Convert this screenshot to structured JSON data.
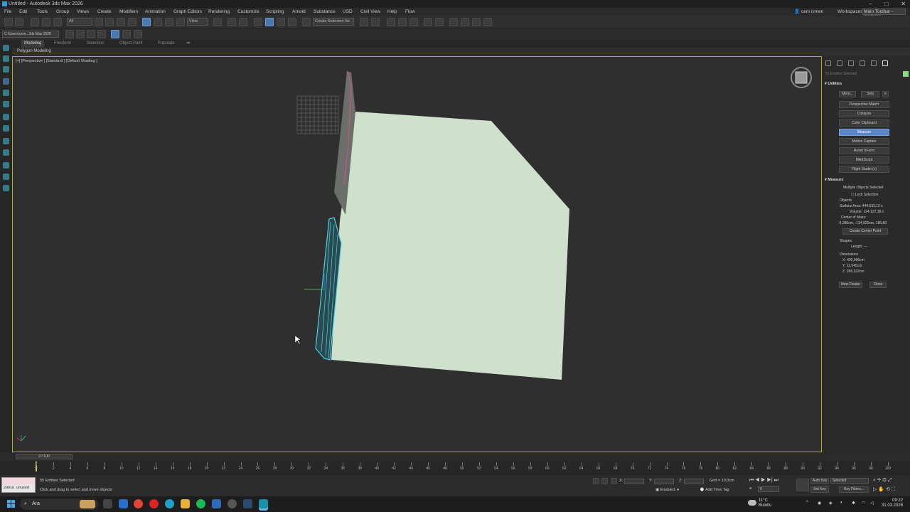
{
  "window": {
    "title": "Untitled - Autodesk 3ds Max 2026",
    "minimize": "–",
    "maximize": "□",
    "close": "✕"
  },
  "menu": {
    "items": [
      "File",
      "Edit",
      "Tools",
      "Group",
      "Views",
      "Create",
      "Modifiers",
      "Animation",
      "Graph Editors",
      "Rendering",
      "Customize",
      "Scripting",
      "Arnold",
      "Substance",
      "USD",
      "Civil View",
      "Help",
      "Flow"
    ],
    "user": "cem ismen",
    "workspaces_label": "Workspaces:",
    "workspace": "Main Toolbar - modular"
  },
  "toolbar": {
    "filter": "All",
    "view": "View",
    "selection_set": "Create Selection Se"
  },
  "project_path": "C:\\Users\\cem...3ds Max 2026",
  "ribbon": {
    "tabs": [
      "Modeling",
      "Freeform",
      "Selection",
      "Object Paint",
      "Populate"
    ],
    "active": "Modeling",
    "panel": "Polygon Modeling"
  },
  "viewport": {
    "label": "[+] [Perspective ] [Standard ] [Default Shading ]"
  },
  "command_panel": {
    "entities_selected": "55 Entities Selected",
    "utilities": {
      "title": "Utilities",
      "more": "More...",
      "sets": "Sets",
      "buttons": [
        "Perspective Match",
        "Collapse",
        "Color Clipboard",
        "Measure",
        "Motion Capture",
        "Reset XForm",
        "MAXScript",
        "Flight Studio (c)"
      ],
      "active": "Measure"
    },
    "measure": {
      "title": "Measure",
      "multiple": "Multiple Objects Selected",
      "lock_selection": "Lock Selection",
      "objects_label": "Objects",
      "surface_area": "Surface Area: 444.633,12 s",
      "volume": "Volume: 124.137,38 c",
      "center_of_mass_label": "Center of Mass:",
      "center_of_mass": "-5,386cm, -134,920cm, 185,80",
      "create_center_point": "Create Center Point",
      "shapes_label": "Shapes",
      "length": "Length: ---",
      "dimensions_label": "Dimensions",
      "dim_x": "X: 400,096cm",
      "dim_y": "Y: 11,545cm",
      "dim_z": "Z: 399,332cm",
      "new_floater": "New Floater",
      "close": "Close"
    }
  },
  "timeline": {
    "slider": "0 / 100",
    "ticks": [
      "0",
      "2",
      "4",
      "6",
      "8",
      "10",
      "12",
      "14",
      "16",
      "18",
      "20",
      "22",
      "24",
      "26",
      "28",
      "30",
      "32",
      "34",
      "36",
      "38",
      "40",
      "42",
      "44",
      "46",
      "48",
      "50",
      "52",
      "54",
      "56",
      "58",
      "60",
      "62",
      "64",
      "66",
      "68",
      "70",
      "72",
      "74",
      "76",
      "78",
      "80",
      "82",
      "84",
      "86",
      "88",
      "90",
      "92",
      "94",
      "96",
      "98",
      "100"
    ]
  },
  "status": {
    "maxscript_text": "28918 unused",
    "entities": "55 Entities Selected",
    "hint": "Click and drag to select and move objects",
    "x_label": "X:",
    "y_label": "Y:",
    "z_label": "Z:",
    "grid": "Grid = 10,0cm",
    "enabled": "Enabled:",
    "add_time_tag": "Add Time Tag",
    "auto_key": "Auto Key",
    "set_key": "Set Key",
    "selected": "Selected",
    "key_filters": "Key Filters...",
    "frame": "0"
  },
  "taskbar": {
    "search": "Ara",
    "weather_temp": "11°C",
    "weather_desc": "Bulutlu",
    "time": "09:22",
    "date": "31.03.2026"
  },
  "colors": {
    "wall": "#cfe0cc",
    "selection": "#49d3e3",
    "viewport_border": "#b3b30c",
    "active_btn": "#5a86c8"
  }
}
